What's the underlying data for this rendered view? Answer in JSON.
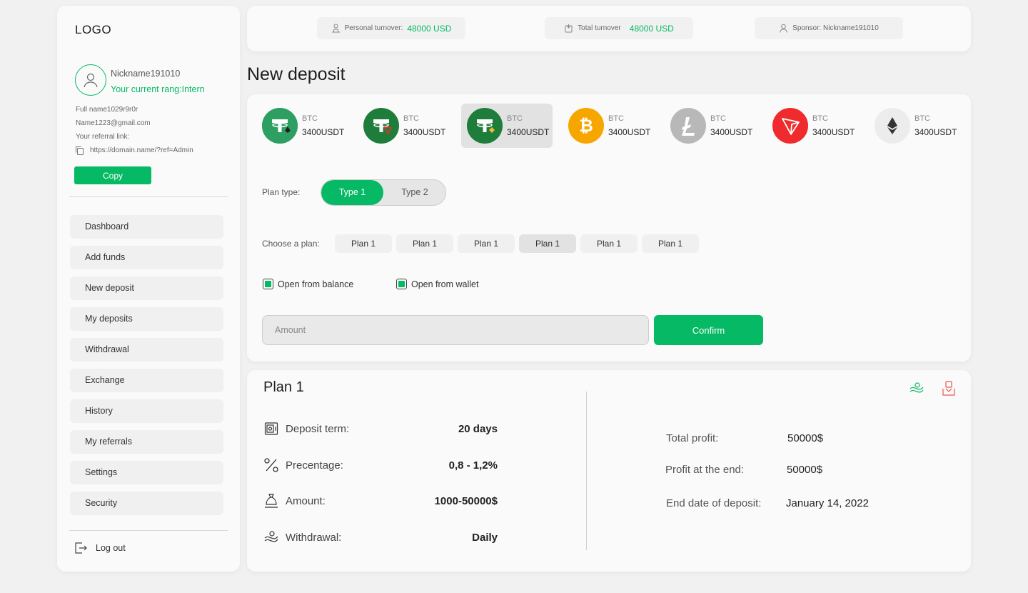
{
  "sidebar": {
    "logo": "LOGO",
    "nickname": "Nickname191010",
    "rang": "Your current rang:Intern",
    "full_name": "Full name1029r9r0r",
    "email": "Name1223@gmail.com",
    "referral_label": "Your referral link:",
    "referral_link": "https://domain.name/?ref=Admin",
    "copy_label": "Copy",
    "menu": [
      "Dashboard",
      "Add funds",
      "New deposit",
      "My deposits",
      "Withdrawal",
      "Exchange",
      "History",
      "My referrals",
      "Settings",
      "Security"
    ],
    "logout_label": "Log out"
  },
  "topbar": {
    "personal_label": "Personal turnover:",
    "personal_value": "48000 USD",
    "total_label": "Total turnover",
    "total_value": "48000 USD",
    "sponsor": "Sponsor: Nickname191010"
  },
  "page_title": "New deposit",
  "deposit": {
    "coins": [
      {
        "label": "BTC",
        "amount": "3400USDT",
        "icon": "tether-eth-icon",
        "color": "#26a17b"
      },
      {
        "label": "BTC",
        "amount": "3400USDT",
        "icon": "tether-trx-icon",
        "color": "#26a17b"
      },
      {
        "label": "BTC",
        "amount": "3400USDT",
        "icon": "tether-bnb-icon",
        "color": "#26a17b"
      },
      {
        "label": "BTC",
        "amount": "3400USDT",
        "icon": "bitcoin-icon",
        "color": "#f7a600"
      },
      {
        "label": "BTC",
        "amount": "3400USDT",
        "icon": "litecoin-icon",
        "color": "#b8b8b8"
      },
      {
        "label": "BTC",
        "amount": "3400USDT",
        "icon": "tron-icon",
        "color": "#ef2b2d"
      },
      {
        "label": "BTC",
        "amount": "3400USDT",
        "icon": "ethereum-icon",
        "color": "#ececec"
      }
    ],
    "plan_type_label": "Plan type:",
    "type1": "Type 1",
    "type2": "Type 2",
    "choose_plan_label": "Choose a plan:",
    "plans": [
      "Plan 1",
      "Plan 1",
      "Plan 1",
      "Plan 1",
      "Plan 1",
      "Plan 1"
    ],
    "open_balance": "Open from balance",
    "open_wallet": "Open from wallet",
    "amount_placeholder": "Amount",
    "confirm_label": "Confirm"
  },
  "plan": {
    "title": "Plan 1",
    "details": [
      {
        "label": "Deposit term:",
        "value": "20 days"
      },
      {
        "label": "Precentage:",
        "value": "0,8 - 1,2%"
      },
      {
        "label": "Amount:",
        "value": "1000-50000$"
      },
      {
        "label": "Withdrawal:",
        "value": "Daily"
      }
    ],
    "total_profit_label": "Total profit:",
    "total_profit_value": "50000$",
    "profit_end_label": "Profit at the end:",
    "profit_end_value": "50000$",
    "end_date_label": "End date of deposit:",
    "end_date_value": "January 14, 2022"
  },
  "colors": {
    "accent": "#06b964",
    "danger": "#ef5350"
  }
}
